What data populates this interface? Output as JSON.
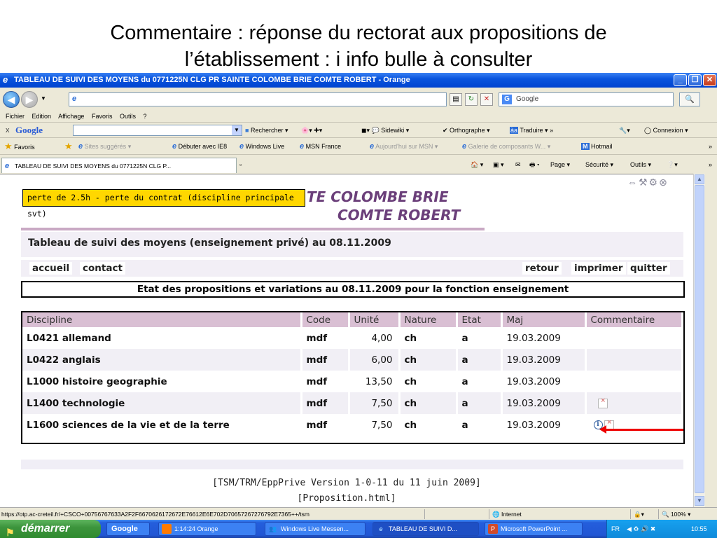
{
  "slide": {
    "title_line1": "Commentaire : réponse du rectorat aux propositions de",
    "title_line2": "l’établissement : i info bulle à consulter"
  },
  "window": {
    "title": "TABLEAU DE SUIVI DES MOYENS du 0771225N  CLG PR SAINTE COLOMBE BRIE COMTE ROBERT - Orange",
    "search_placeholder": "Google"
  },
  "menu": [
    "Fichier",
    "Edition",
    "Affichage",
    "Favoris",
    "Outils",
    "?"
  ],
  "google_toolbar": {
    "logo": "Google",
    "rechercher": "Rechercher",
    "sidewiki": "Sidewiki",
    "orthographe": "Orthographe",
    "traduire": "Traduire",
    "connexion": "Connexion"
  },
  "favorites": {
    "favoris": "Favoris",
    "sites": "Sites suggérés",
    "debuter": "Débuter avec IE8",
    "windows_live": "Windows Live",
    "msn": "MSN France",
    "aujourdhui": "Aujourd'hui sur MSN",
    "galerie": "Galerie de composants W...",
    "hotmail": "Hotmail"
  },
  "tab": {
    "label": "TABLEAU DE SUIVI DES MOYENS du 0771225N  CLG P...",
    "page": "Page",
    "securite": "Sécurité",
    "outils": "Outils"
  },
  "page": {
    "tooltip": "perte de 2.5h - perte du contrat (discipline principale svt)",
    "school_line1": "TE COLOMBE BRIE",
    "school_line2": "COMTE ROBERT",
    "subtitle": "Tableau de suivi des moyens (enseignement privé) au 08.11.2009",
    "nav": {
      "accueil": "accueil",
      "contact": "contact",
      "retour": "retour",
      "imprimer": "imprimer",
      "quitter": "quitter"
    },
    "state_title": "Etat des propositions et variations au 08.11.2009 pour la fonction enseignement",
    "table": {
      "headers": [
        "Discipline",
        "Code",
        "Unité",
        "Nature",
        "Etat",
        "Maj",
        "Commentaire"
      ],
      "rows": [
        [
          "L0421  allemand",
          "mdf",
          "4,00",
          "ch",
          "a",
          "19.03.2009",
          ""
        ],
        [
          "L0422  anglais",
          "mdf",
          "6,00",
          "ch",
          "a",
          "19.03.2009",
          ""
        ],
        [
          "L1000  histoire geographie",
          "mdf",
          "13,50",
          "ch",
          "a",
          "19.03.2009",
          ""
        ],
        [
          "L1400  technologie",
          "mdf",
          "7,50",
          "ch",
          "a",
          "19.03.2009",
          ""
        ],
        [
          "L1600  sciences de la vie et de la terre",
          "mdf",
          "7,50",
          "ch",
          "a",
          "19.03.2009",
          ""
        ]
      ]
    },
    "version": "[TSM/TRM/EppPrive Version 1-0-11 du 11 juin 2009]",
    "file": "[Proposition.html]"
  },
  "status": {
    "url": "https://otp.ac-creteil.fr/+CSCO+00756767633A2F2F6670626172672E76612E6E702D70657267276792E7365++/tsm",
    "zone": "Internet",
    "zoom": "100%"
  },
  "taskbar": {
    "start": "démarrer",
    "google": "Google",
    "orange": "1:14:24 Orange",
    "messenger": "Windows Live Messen...",
    "tableau": "TABLEAU DE SUIVI D...",
    "powerpoint": "Microsoft PowerPoint ...",
    "lang": "FR",
    "clock": "10:55"
  }
}
